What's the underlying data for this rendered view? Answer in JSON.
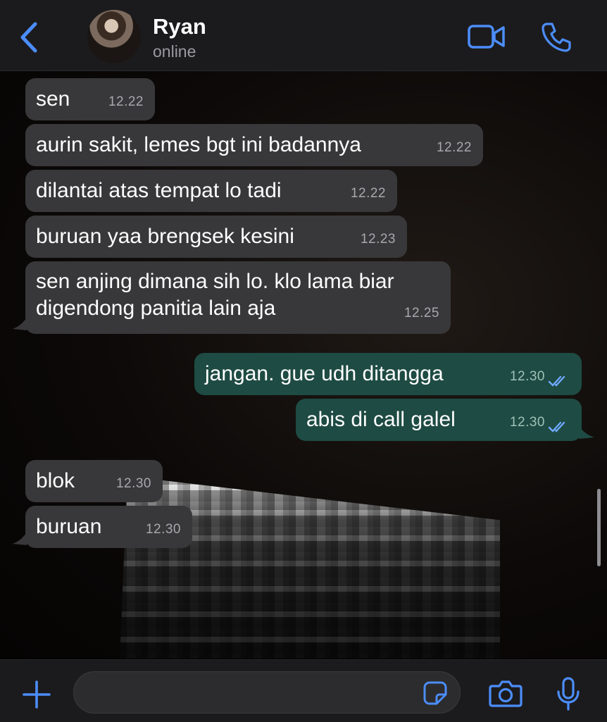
{
  "header": {
    "contact_name": "Ryan",
    "status": "online",
    "back_icon": "chevron-left-icon",
    "video_icon": "video-call-icon",
    "phone_icon": "phone-icon"
  },
  "messages": [
    {
      "direction": "incoming",
      "text": "sen",
      "time": "12.22"
    },
    {
      "direction": "incoming",
      "text": "aurin sakit, lemes bgt ini badannya",
      "time": "12.22"
    },
    {
      "direction": "incoming",
      "text": "dilantai atas tempat lo tadi",
      "time": "12.22"
    },
    {
      "direction": "incoming",
      "text": "buruan yaa brengsek kesini",
      "time": "12.23"
    },
    {
      "direction": "incoming",
      "text": "sen anjing dimana sih lo. klo lama biar\ndigendong panitia lain aja",
      "time": "12.25"
    },
    {
      "direction": "outgoing",
      "text": "jangan. gue udh ditangga",
      "time": "12.30",
      "status": "read"
    },
    {
      "direction": "outgoing",
      "text": "abis di call galel",
      "time": "12.30",
      "status": "read"
    },
    {
      "direction": "incoming",
      "text": "blok",
      "time": "12.30"
    },
    {
      "direction": "incoming",
      "text": "buruan",
      "time": "12.30"
    }
  ],
  "footer": {
    "plus_icon": "plus-icon",
    "sticker_icon": "sticker-icon",
    "camera_icon": "camera-icon",
    "mic_icon": "microphone-icon"
  },
  "colors": {
    "accent": "#4c8dfa",
    "incoming_bubble": "#38383a",
    "outgoing_bubble": "#1e4b43",
    "read_ticks": "#6fa8ff"
  }
}
